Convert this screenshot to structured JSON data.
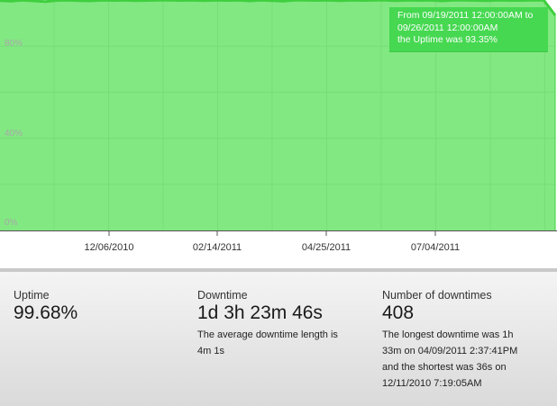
{
  "chart_data": {
    "type": "area",
    "title": "",
    "xlabel": "",
    "ylabel": "",
    "ylim": [
      0,
      100
    ],
    "y_ticks": [
      "0%",
      "40%",
      "80%"
    ],
    "x_ticks": [
      "12/06/2010",
      "02/14/2011",
      "04/25/2011",
      "07/04/2011"
    ],
    "x": [
      "2010-10-18",
      "2010-10-25",
      "2010-11-01",
      "2010-11-08",
      "2010-11-15",
      "2010-11-22",
      "2010-11-29",
      "2010-12-06",
      "2010-12-13",
      "2010-12-20",
      "2010-12-27",
      "2011-01-03",
      "2011-01-10",
      "2011-01-17",
      "2011-01-24",
      "2011-01-31",
      "2011-02-07",
      "2011-02-14",
      "2011-02-21",
      "2011-02-28",
      "2011-03-07",
      "2011-03-14",
      "2011-03-21",
      "2011-03-28",
      "2011-04-04",
      "2011-04-11",
      "2011-04-18",
      "2011-04-25",
      "2011-05-02",
      "2011-05-09",
      "2011-05-16",
      "2011-05-23",
      "2011-05-30",
      "2011-06-06",
      "2011-06-13",
      "2011-06-20",
      "2011-06-27",
      "2011-07-04",
      "2011-07-11",
      "2011-07-18",
      "2011-07-25",
      "2011-08-01",
      "2011-08-08",
      "2011-08-15",
      "2011-08-22",
      "2011-08-29",
      "2011-09-05",
      "2011-09-12",
      "2011-09-19",
      "2011-09-26"
    ],
    "values": [
      99.7,
      99.5,
      99.9,
      99.6,
      99.3,
      99.8,
      99.9,
      99.7,
      99.6,
      99.9,
      99.8,
      99.9,
      99.7,
      99.8,
      99.9,
      99.9,
      99.8,
      99.9,
      99.7,
      99.9,
      99.8,
      99.9,
      99.6,
      99.9,
      99.7,
      99.5,
      99.9,
      99.9,
      99.8,
      99.9,
      99.7,
      99.9,
      99.8,
      99.9,
      99.9,
      99.7,
      99.9,
      99.8,
      99.9,
      99.6,
      99.9,
      99.9,
      99.8,
      99.7,
      99.9,
      99.8,
      99.8,
      99.9,
      99.9,
      93.35
    ],
    "colors": {
      "line": "#3fcf3f",
      "fill": "#82e882",
      "grid": "#6fd76f",
      "axis": "#555555"
    },
    "grid": true
  },
  "tooltip": {
    "line1": "From 09/19/2011 12:00:00AM to",
    "line2": "09/26/2011 12:00:00AM",
    "line3": "the Uptime was 93.35%"
  },
  "summary": {
    "uptime": {
      "label": "Uptime",
      "value": "99.68%"
    },
    "downtime": {
      "label": "Downtime",
      "value": "1d 3h 23m 46s",
      "note_line1": "The average downtime length is",
      "note_line2": "4m 1s"
    },
    "downtimes": {
      "label": "Number of downtimes",
      "value": "408",
      "note_line1": "The longest downtime was 1h",
      "note_line2": "33m on 04/09/2011 2:37:41PM",
      "note_line3": "and the shortest was 36s on",
      "note_line4": "12/11/2010 7:19:05AM"
    }
  }
}
